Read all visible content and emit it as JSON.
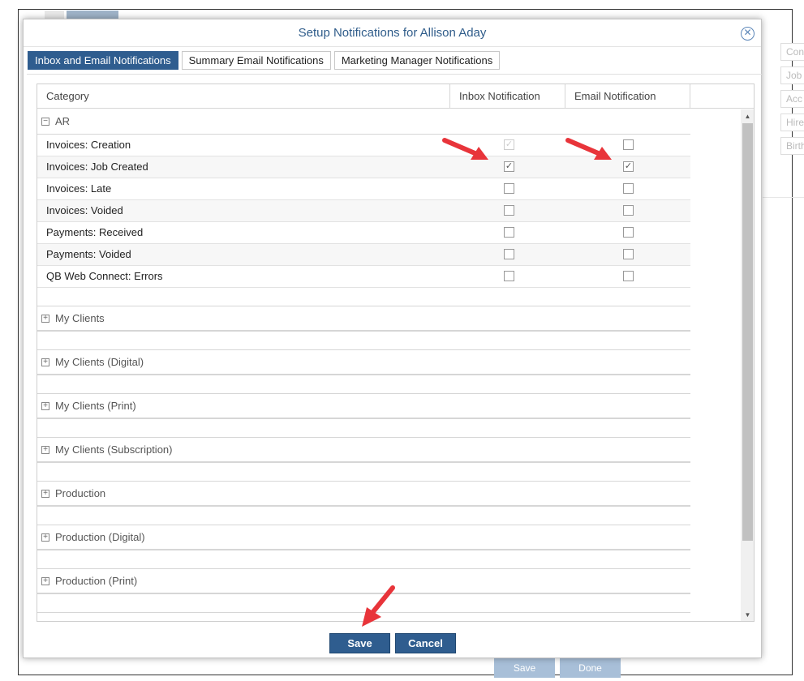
{
  "background": {
    "side_fields": [
      "Con",
      "Job",
      "Acc",
      "Hire",
      "Birth"
    ],
    "save_label": "Save",
    "done_label": "Done"
  },
  "dialog": {
    "title": "Setup Notifications for Allison Aday",
    "tabs": [
      {
        "label": "Inbox and Email Notifications",
        "active": true
      },
      {
        "label": "Summary Email Notifications",
        "active": false
      },
      {
        "label": "Marketing Manager Notifications",
        "active": false
      }
    ],
    "columns": {
      "category": "Category",
      "inbox": "Inbox Notification",
      "email": "Email Notification"
    },
    "expanded_group": {
      "name": "AR",
      "items": [
        {
          "label": "Invoices: Creation",
          "inbox": true,
          "inbox_disabled": true,
          "email": false
        },
        {
          "label": "Invoices: Job Created",
          "inbox": true,
          "inbox_disabled": false,
          "email": true
        },
        {
          "label": "Invoices: Late",
          "inbox": false,
          "inbox_disabled": false,
          "email": false
        },
        {
          "label": "Invoices: Voided",
          "inbox": false,
          "inbox_disabled": false,
          "email": false
        },
        {
          "label": "Payments: Received",
          "inbox": false,
          "inbox_disabled": false,
          "email": false
        },
        {
          "label": "Payments: Voided",
          "inbox": false,
          "inbox_disabled": false,
          "email": false
        },
        {
          "label": "QB Web Connect: Errors",
          "inbox": false,
          "inbox_disabled": false,
          "email": false
        }
      ]
    },
    "collapsed_groups": [
      "My Clients",
      "My Clients (Digital)",
      "My Clients (Print)",
      "My Clients (Subscription)",
      "Production",
      "Production (Digital)",
      "Production (Print)"
    ],
    "save_label": "Save",
    "cancel_label": "Cancel",
    "accent_color": "#2f5d8f",
    "annotation_color": "#e8343a"
  }
}
